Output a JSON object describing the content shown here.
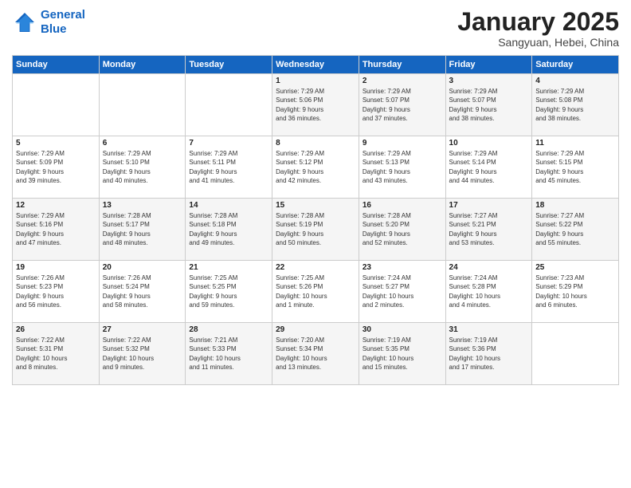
{
  "logo": {
    "line1": "General",
    "line2": "Blue"
  },
  "title": "January 2025",
  "subtitle": "Sangyuan, Hebei, China",
  "days_of_week": [
    "Sunday",
    "Monday",
    "Tuesday",
    "Wednesday",
    "Thursday",
    "Friday",
    "Saturday"
  ],
  "weeks": [
    [
      {
        "day": "",
        "info": ""
      },
      {
        "day": "",
        "info": ""
      },
      {
        "day": "",
        "info": ""
      },
      {
        "day": "1",
        "info": "Sunrise: 7:29 AM\nSunset: 5:06 PM\nDaylight: 9 hours\nand 36 minutes."
      },
      {
        "day": "2",
        "info": "Sunrise: 7:29 AM\nSunset: 5:07 PM\nDaylight: 9 hours\nand 37 minutes."
      },
      {
        "day": "3",
        "info": "Sunrise: 7:29 AM\nSunset: 5:07 PM\nDaylight: 9 hours\nand 38 minutes."
      },
      {
        "day": "4",
        "info": "Sunrise: 7:29 AM\nSunset: 5:08 PM\nDaylight: 9 hours\nand 38 minutes."
      }
    ],
    [
      {
        "day": "5",
        "info": "Sunrise: 7:29 AM\nSunset: 5:09 PM\nDaylight: 9 hours\nand 39 minutes."
      },
      {
        "day": "6",
        "info": "Sunrise: 7:29 AM\nSunset: 5:10 PM\nDaylight: 9 hours\nand 40 minutes."
      },
      {
        "day": "7",
        "info": "Sunrise: 7:29 AM\nSunset: 5:11 PM\nDaylight: 9 hours\nand 41 minutes."
      },
      {
        "day": "8",
        "info": "Sunrise: 7:29 AM\nSunset: 5:12 PM\nDaylight: 9 hours\nand 42 minutes."
      },
      {
        "day": "9",
        "info": "Sunrise: 7:29 AM\nSunset: 5:13 PM\nDaylight: 9 hours\nand 43 minutes."
      },
      {
        "day": "10",
        "info": "Sunrise: 7:29 AM\nSunset: 5:14 PM\nDaylight: 9 hours\nand 44 minutes."
      },
      {
        "day": "11",
        "info": "Sunrise: 7:29 AM\nSunset: 5:15 PM\nDaylight: 9 hours\nand 45 minutes."
      }
    ],
    [
      {
        "day": "12",
        "info": "Sunrise: 7:29 AM\nSunset: 5:16 PM\nDaylight: 9 hours\nand 47 minutes."
      },
      {
        "day": "13",
        "info": "Sunrise: 7:28 AM\nSunset: 5:17 PM\nDaylight: 9 hours\nand 48 minutes."
      },
      {
        "day": "14",
        "info": "Sunrise: 7:28 AM\nSunset: 5:18 PM\nDaylight: 9 hours\nand 49 minutes."
      },
      {
        "day": "15",
        "info": "Sunrise: 7:28 AM\nSunset: 5:19 PM\nDaylight: 9 hours\nand 50 minutes."
      },
      {
        "day": "16",
        "info": "Sunrise: 7:28 AM\nSunset: 5:20 PM\nDaylight: 9 hours\nand 52 minutes."
      },
      {
        "day": "17",
        "info": "Sunrise: 7:27 AM\nSunset: 5:21 PM\nDaylight: 9 hours\nand 53 minutes."
      },
      {
        "day": "18",
        "info": "Sunrise: 7:27 AM\nSunset: 5:22 PM\nDaylight: 9 hours\nand 55 minutes."
      }
    ],
    [
      {
        "day": "19",
        "info": "Sunrise: 7:26 AM\nSunset: 5:23 PM\nDaylight: 9 hours\nand 56 minutes."
      },
      {
        "day": "20",
        "info": "Sunrise: 7:26 AM\nSunset: 5:24 PM\nDaylight: 9 hours\nand 58 minutes."
      },
      {
        "day": "21",
        "info": "Sunrise: 7:25 AM\nSunset: 5:25 PM\nDaylight: 9 hours\nand 59 minutes."
      },
      {
        "day": "22",
        "info": "Sunrise: 7:25 AM\nSunset: 5:26 PM\nDaylight: 10 hours\nand 1 minute."
      },
      {
        "day": "23",
        "info": "Sunrise: 7:24 AM\nSunset: 5:27 PM\nDaylight: 10 hours\nand 2 minutes."
      },
      {
        "day": "24",
        "info": "Sunrise: 7:24 AM\nSunset: 5:28 PM\nDaylight: 10 hours\nand 4 minutes."
      },
      {
        "day": "25",
        "info": "Sunrise: 7:23 AM\nSunset: 5:29 PM\nDaylight: 10 hours\nand 6 minutes."
      }
    ],
    [
      {
        "day": "26",
        "info": "Sunrise: 7:22 AM\nSunset: 5:31 PM\nDaylight: 10 hours\nand 8 minutes."
      },
      {
        "day": "27",
        "info": "Sunrise: 7:22 AM\nSunset: 5:32 PM\nDaylight: 10 hours\nand 9 minutes."
      },
      {
        "day": "28",
        "info": "Sunrise: 7:21 AM\nSunset: 5:33 PM\nDaylight: 10 hours\nand 11 minutes."
      },
      {
        "day": "29",
        "info": "Sunrise: 7:20 AM\nSunset: 5:34 PM\nDaylight: 10 hours\nand 13 minutes."
      },
      {
        "day": "30",
        "info": "Sunrise: 7:19 AM\nSunset: 5:35 PM\nDaylight: 10 hours\nand 15 minutes."
      },
      {
        "day": "31",
        "info": "Sunrise: 7:19 AM\nSunset: 5:36 PM\nDaylight: 10 hours\nand 17 minutes."
      },
      {
        "day": "",
        "info": ""
      }
    ]
  ]
}
